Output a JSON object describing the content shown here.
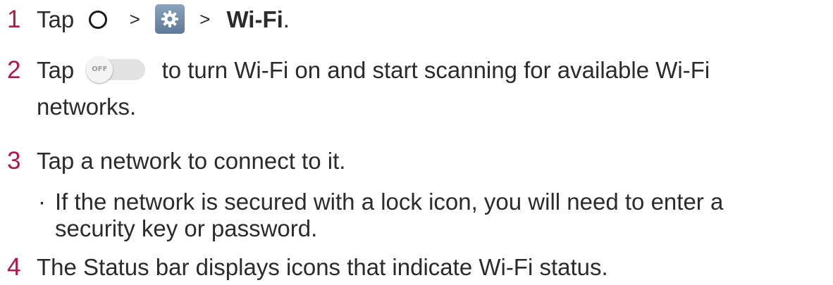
{
  "steps": [
    {
      "number": "1",
      "prefix": "Tap",
      "sep1": ">",
      "sep2": ">",
      "target": "Wi-Fi",
      "suffix": "."
    },
    {
      "number": "2",
      "prefix": "Tap",
      "toggle_label": "OFF",
      "text": "to turn Wi-Fi on and start scanning for available Wi-Fi",
      "text_cont": "networks."
    },
    {
      "number": "3",
      "text": "Tap a network to connect to it.",
      "bullet": {
        "marker": "·",
        "line1": "If the network is secured with a lock icon, you will need to enter a",
        "line2": "security key or password."
      }
    },
    {
      "number": "4",
      "text": "The Status bar displays icons that indicate Wi-Fi status."
    }
  ],
  "colors": {
    "step_number": "#b0184b",
    "body_text": "#2b2b2b",
    "settings_tile": "#6f8aa8",
    "toggle_track": "#e2e2e2"
  },
  "icons": [
    "home-circle-icon",
    "settings-gear-icon",
    "wifi-off-toggle-icon"
  ]
}
